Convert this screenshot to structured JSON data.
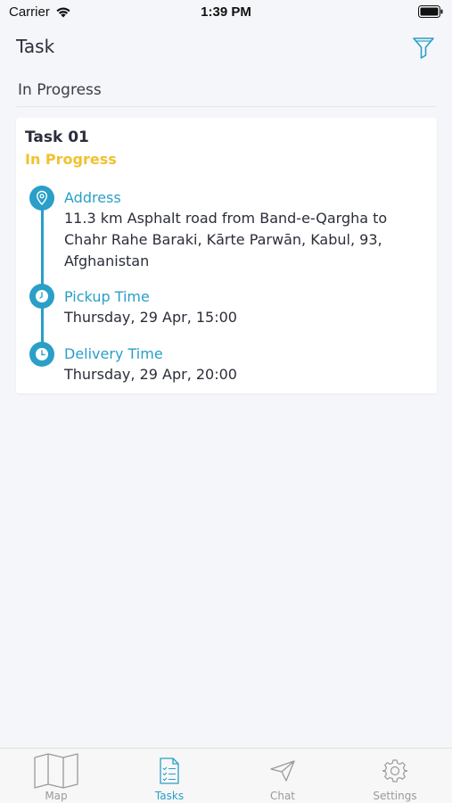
{
  "status_bar": {
    "carrier": "Carrier",
    "time": "1:39 PM"
  },
  "header": {
    "title": "Task",
    "filter_icon": "filter-icon"
  },
  "section": {
    "title": "In Progress"
  },
  "task": {
    "name": "Task 01",
    "status": "In Progress",
    "status_color": "#f2c12e",
    "address_label": "Address",
    "address_lines": [
      "11.3 km Asphalt road from Band-e-Qargha to",
      "Chahr Rahe Baraki, Kārte Parwān, Kabul, 93,",
      "Afghanistan"
    ],
    "pickup_label": "Pickup Time",
    "pickup_value": "Thursday, 29 Apr, 15:00",
    "delivery_label": "Delivery Time",
    "delivery_value": "Thursday, 29 Apr, 20:00"
  },
  "tab_bar": {
    "items": [
      {
        "label": "Map",
        "icon": "map-icon"
      },
      {
        "label": "Tasks",
        "icon": "tasks-icon"
      },
      {
        "label": "Chat",
        "icon": "send-icon"
      },
      {
        "label": "Settings",
        "icon": "gear-icon"
      }
    ],
    "active": "Tasks"
  },
  "colors": {
    "accent": "#2a9fc7",
    "background": "#f4f6f9",
    "text": "#2b2e3a"
  }
}
